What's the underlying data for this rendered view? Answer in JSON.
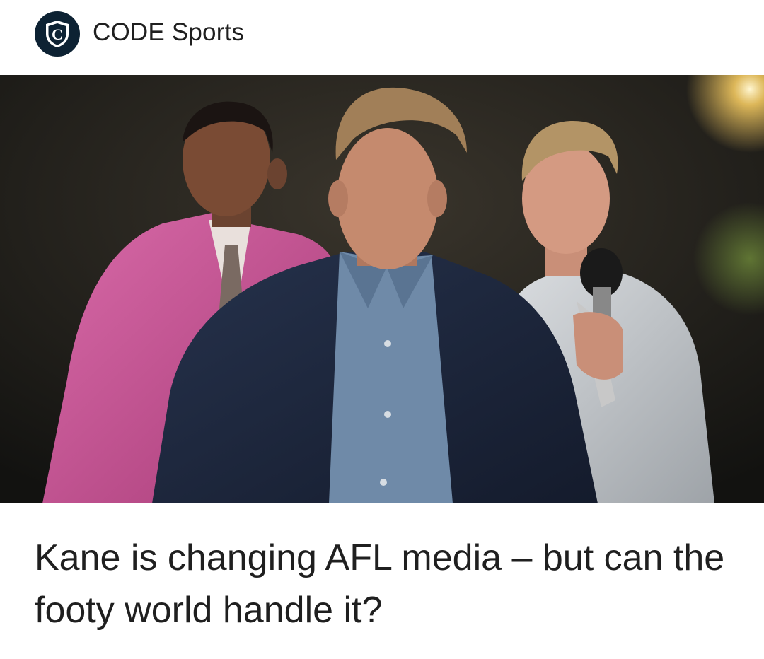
{
  "publisher": {
    "name": "CODE Sports",
    "logo_icon": "code-sports-shield-icon",
    "logo_letter": "C",
    "logo_color": "#0d2233"
  },
  "article": {
    "headline": "Kane is changing AFL media – but can the footy world handle it?"
  },
  "hero_image": {
    "icon": "article-hero-image",
    "subjects": [
      "man-in-pink-suit",
      "man-in-navy-blazer",
      "man-with-microphone"
    ]
  }
}
